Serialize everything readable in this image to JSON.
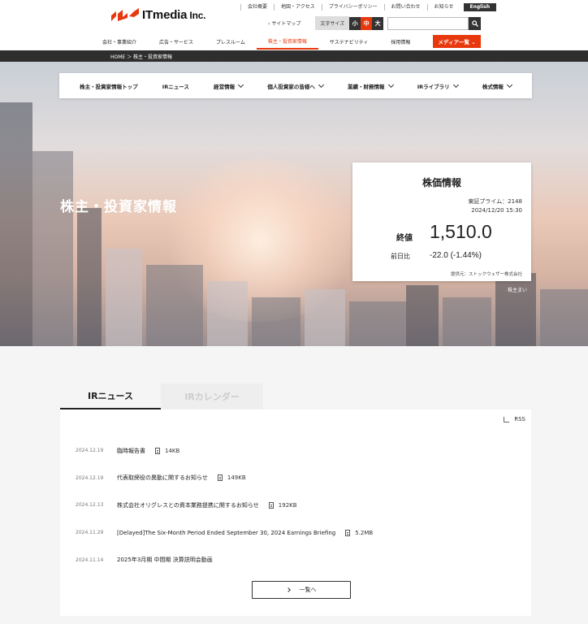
{
  "header": {
    "logo_text": "ITmedia",
    "logo_suffix": " Inc.",
    "util_links": [
      "会社概要",
      "地図・アクセス",
      "プライバシーポリシー",
      "お問い合わせ",
      "お知らせ"
    ],
    "english": "English",
    "sitemap": "サイトマップ",
    "font_size_label": "文字サイズ",
    "font_sizes": [
      "小",
      "中",
      "大"
    ],
    "nav": [
      "会社・事業紹介",
      "広告・サービス",
      "プレスルーム",
      "株主・投資家情報",
      "サステナビリティ",
      "採用情報"
    ],
    "media_list": "メディア一覧"
  },
  "breadcrumb": "HOME ＞ 株主・投資家情報",
  "subnav": [
    "株主・投資家情報トップ",
    "IRニュース",
    "経営情報",
    "個人投資家の皆様へ",
    "業績・財務情報",
    "IRライブラリ",
    "株式情報"
  ],
  "hero": {
    "title": "株主・投資家情報",
    "note": "株主まい"
  },
  "stock": {
    "title": "株価情報",
    "market": "東証プライム：2148",
    "datetime": "2024/12/20 15:30",
    "close_label": "終値",
    "close_value": "1,510.0",
    "change_label": "前日比",
    "change_value": "-22.0 (-1.44%)",
    "source": "提供元：ストックウェザー株式会社"
  },
  "ir": {
    "tabs": [
      "IRニュース",
      "IRカレンダー"
    ],
    "rss": "RSS",
    "news": [
      {
        "date": "2024.12.19",
        "title": "臨時報告書",
        "size": "14KB"
      },
      {
        "date": "2024.12.19",
        "title": "代表取締役の異動に関するお知らせ",
        "size": "149KB"
      },
      {
        "date": "2024.12.13",
        "title": "株式会社オリグレスとの資本業務提携に関するお知らせ",
        "size": "192KB"
      },
      {
        "date": "2024.11.29",
        "title": "[Delayed]The Six-Month Period Ended September 30, 2024 Earnings Briefing",
        "size": "5.2MB"
      },
      {
        "date": "2024.11.14",
        "title": "2025年3月期 中間期 決算説明会動画",
        "size": ""
      }
    ],
    "more": "一覧へ"
  }
}
